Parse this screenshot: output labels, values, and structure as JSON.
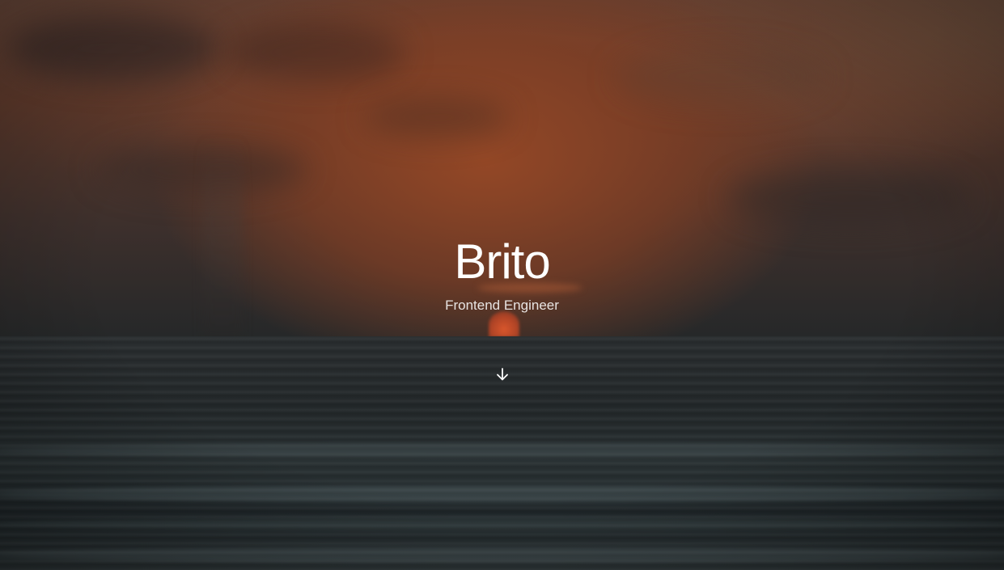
{
  "hero": {
    "title": "Brito",
    "subtitle": "Frontend Engineer",
    "scroll_icon": "arrow-down-icon"
  },
  "colors": {
    "text": "#ffffff",
    "sky": "#8a4a2e",
    "sea": "#23282a"
  }
}
